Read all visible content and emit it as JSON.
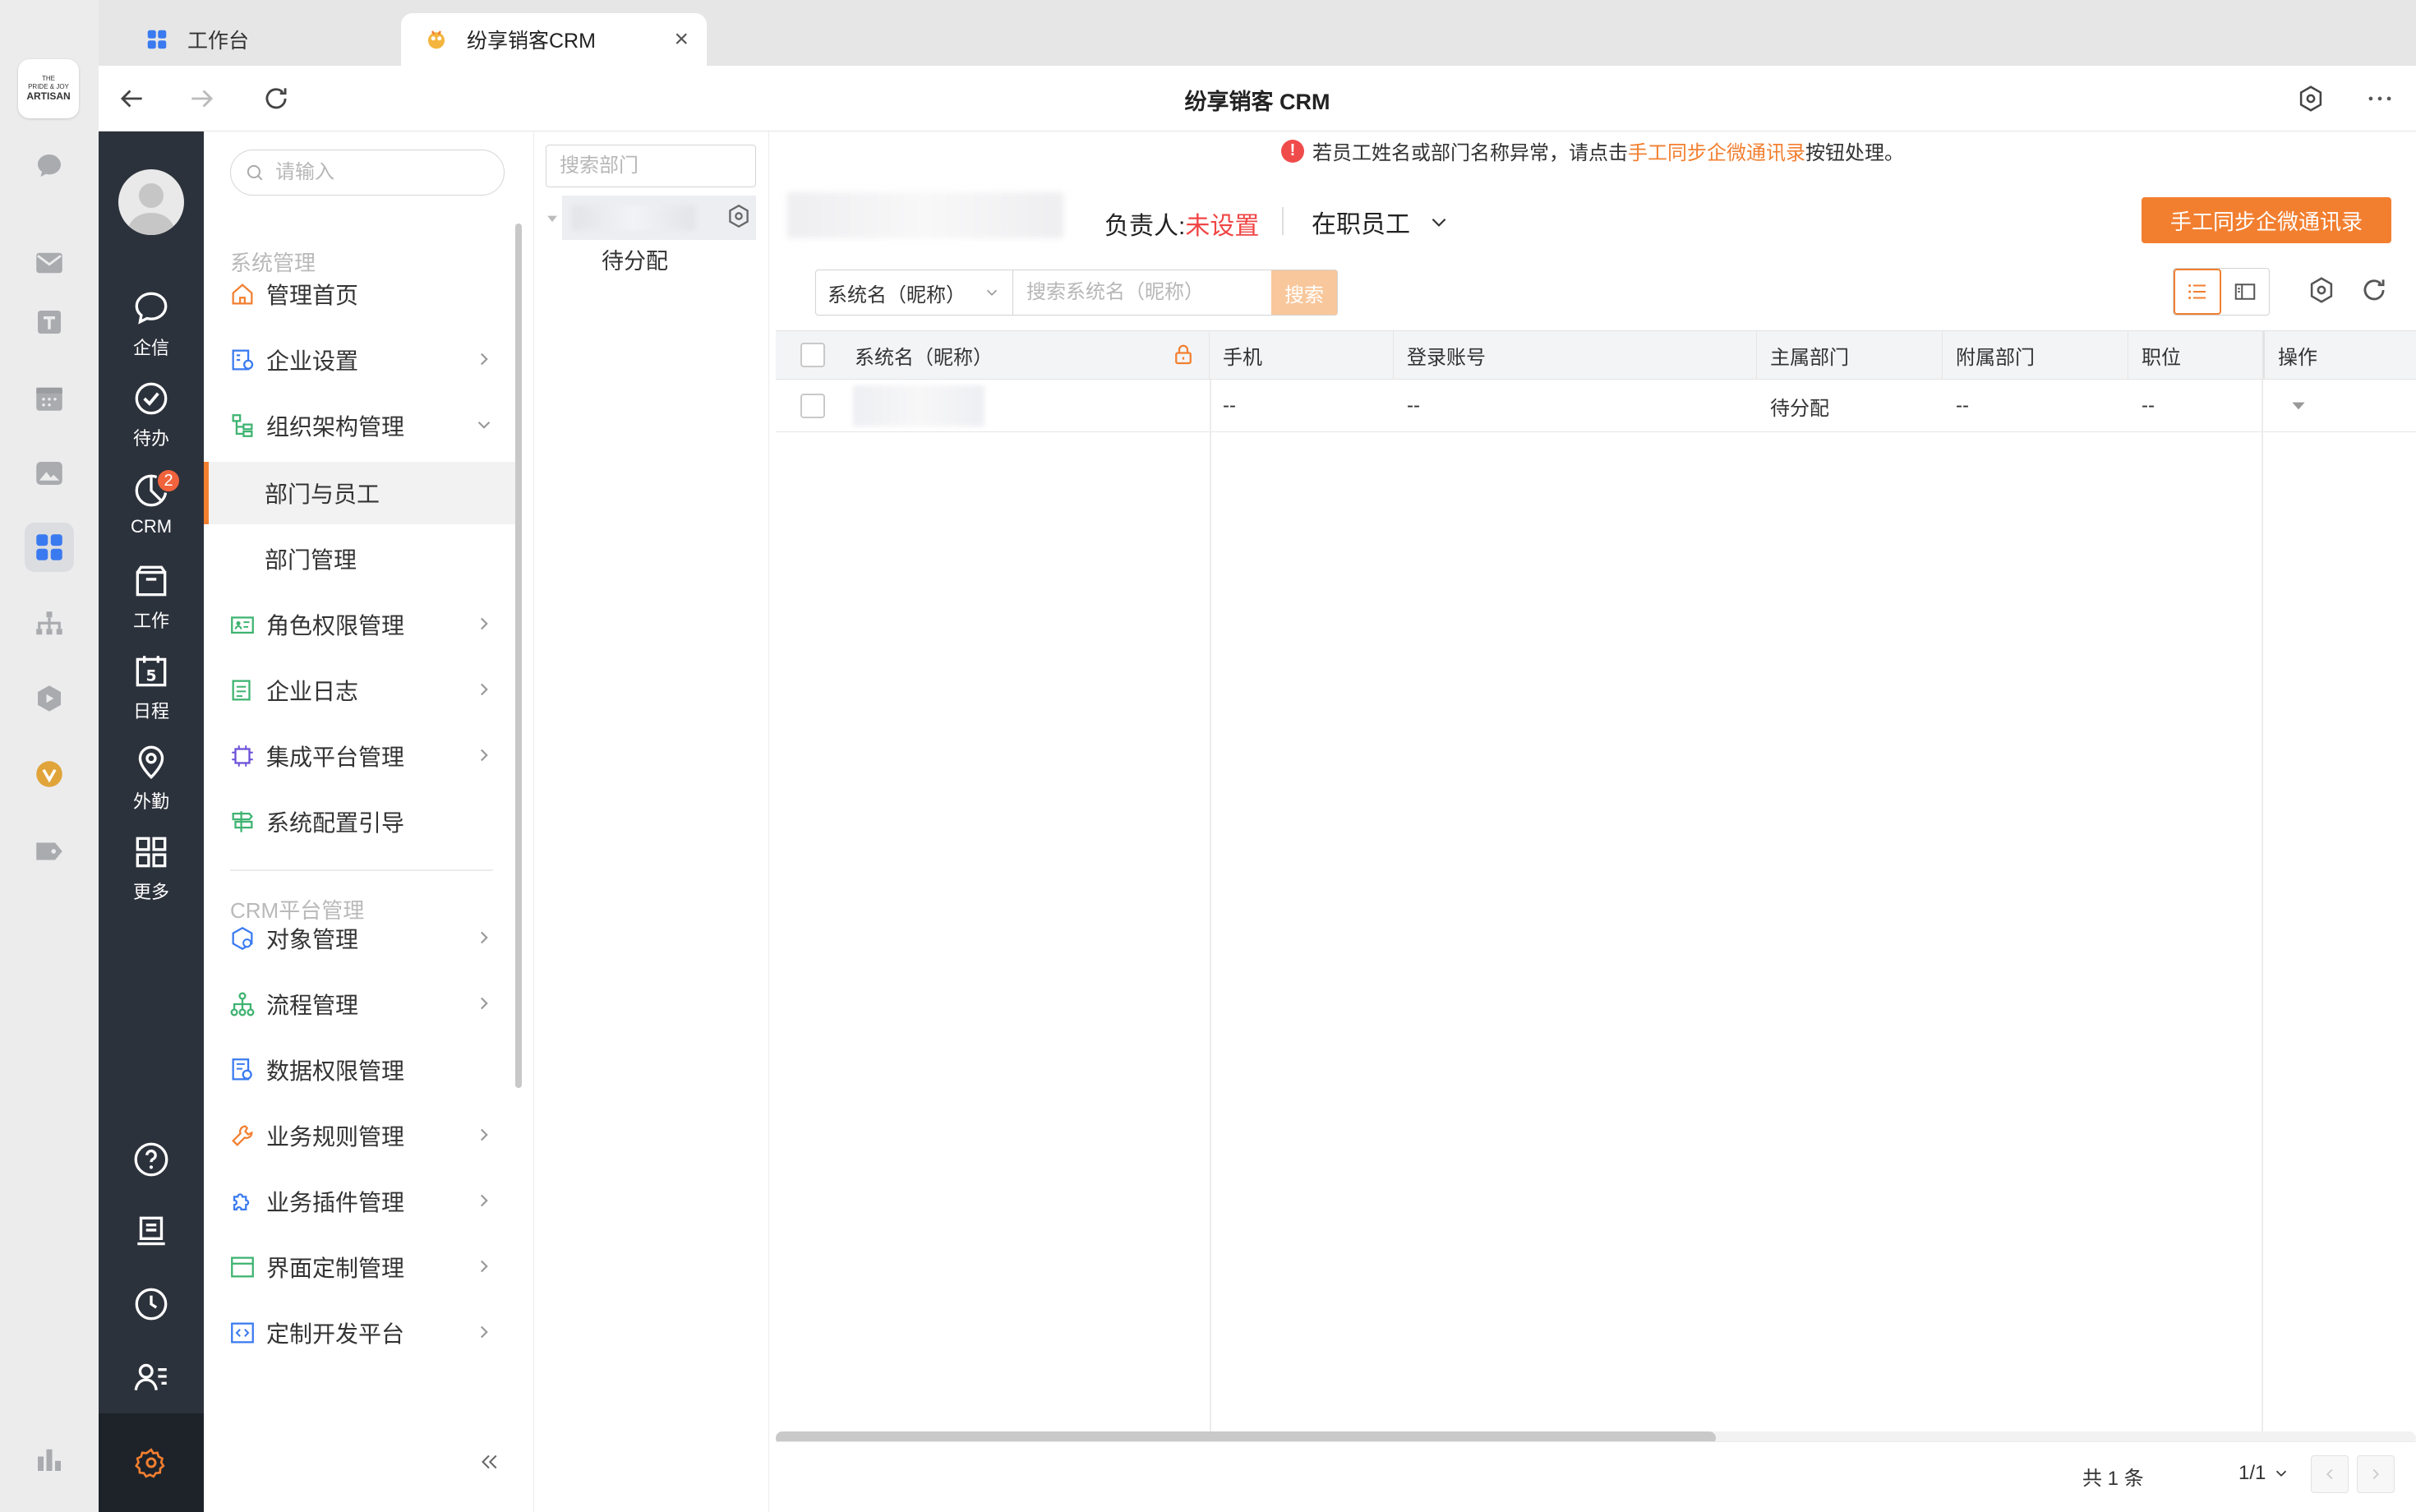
{
  "outer_bar": {
    "logo_lines": [
      "THE",
      "PRIDE & JOY",
      "ARTISAN"
    ]
  },
  "tabs": [
    {
      "label": "工作台",
      "icon": "grid-icon"
    },
    {
      "label": "纷享销客CRM",
      "icon": "crm-logo-icon"
    }
  ],
  "nav": {
    "title": "纷享销客 CRM"
  },
  "crm_sidebar": {
    "items": [
      {
        "label": "企信",
        "icon": "chat-bubble-icon"
      },
      {
        "label": "待办",
        "icon": "check-circle-icon"
      },
      {
        "label": "CRM",
        "icon": "pie-chart-icon",
        "badge": "2"
      },
      {
        "label": "工作",
        "icon": "briefcase-icon"
      },
      {
        "label": "日程",
        "icon": "calendar-icon",
        "day": "5"
      },
      {
        "label": "外勤",
        "icon": "location-pin-icon"
      },
      {
        "label": "更多",
        "icon": "apps-grid-icon"
      }
    ]
  },
  "menu": {
    "search_placeholder": "请输入",
    "section1": "系统管理",
    "section2": "CRM平台管理",
    "items": [
      {
        "label": "管理首页",
        "icon": "home-icon"
      },
      {
        "label": "企业设置",
        "icon": "enterprise-settings-icon"
      },
      {
        "label": "组织架构管理",
        "icon": "org-tree-icon"
      },
      {
        "label": "部门与员工"
      },
      {
        "label": "部门管理"
      },
      {
        "label": "角色权限管理",
        "icon": "id-card-icon"
      },
      {
        "label": "企业日志",
        "icon": "log-icon"
      },
      {
        "label": "集成平台管理",
        "icon": "chip-icon"
      },
      {
        "label": "系统配置引导",
        "icon": "signpost-icon"
      },
      {
        "label": "对象管理",
        "icon": "cube-icon"
      },
      {
        "label": "流程管理",
        "icon": "flow-icon"
      },
      {
        "label": "数据权限管理",
        "icon": "data-permission-icon"
      },
      {
        "label": "业务规则管理",
        "icon": "wrench-icon"
      },
      {
        "label": "业务插件管理",
        "icon": "puzzle-icon"
      },
      {
        "label": "界面定制管理",
        "icon": "layout-icon"
      },
      {
        "label": "定制开发平台",
        "icon": "code-icon"
      }
    ]
  },
  "tree": {
    "search_placeholder": "搜索部门",
    "child": "待分配"
  },
  "main": {
    "notice_prefix": "若员工姓名或部门名称异常，请点击",
    "notice_link": "手工同步企微通讯录",
    "notice_suffix": "按钮处理。",
    "owner_label": "负责人:",
    "owner_value": "未设置",
    "employee_filter": "在职员工",
    "sync_button": "手工同步企微通讯录",
    "search_field": "系统名（昵称）",
    "search_placeholder": "搜索系统名（昵称）",
    "search_button": "搜索"
  },
  "table": {
    "columns": [
      "系统名（昵称）",
      "手机",
      "登录账号",
      "主属部门",
      "附属部门",
      "职位",
      "操作"
    ],
    "rows": [
      {
        "name": "",
        "phone": "--",
        "account": "--",
        "main_dept": "待分配",
        "sub_dept": "--",
        "position": "--"
      }
    ]
  },
  "pager": {
    "total": "共 1 条",
    "page": "1/1"
  },
  "colors": {
    "accent": "#f27f30",
    "danger": "#f04545",
    "sidebar_dark": "#2c323c"
  }
}
